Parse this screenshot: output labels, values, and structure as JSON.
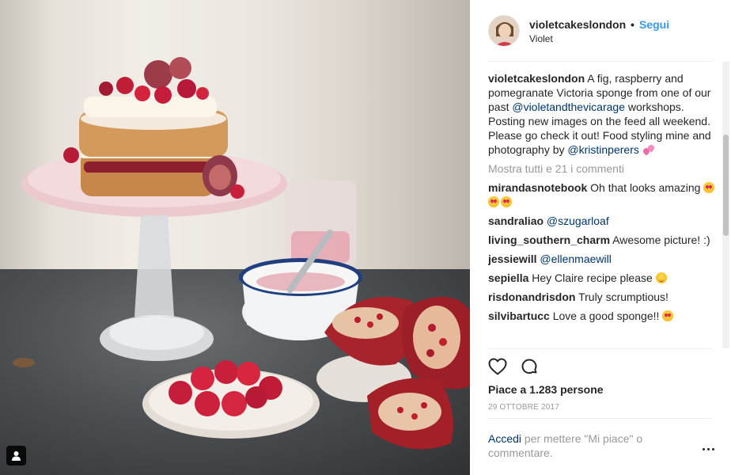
{
  "post": {
    "username": "violetcakeslondon",
    "separator": "•",
    "follow_label": "Segui",
    "full_name": "Violet",
    "caption": {
      "username": "violetcakeslondon",
      "text_1": " A fig, raspberry and pomegranate Victoria sponge from one of our past ",
      "mention_1": "@violetandthevicarage",
      "text_2": " workshops. Posting new images on the feed all weekend. Please go check it out! Food styling mine and photography by ",
      "mention_2": "@kristinperers",
      "emoji": "two-hearts"
    },
    "view_all_comments": "Mostra tutti e 21 i commenti",
    "comments": [
      {
        "username": "mirandasnotebook",
        "text": " Oh that looks amazing ",
        "emoji": "heart-eyes x3"
      },
      {
        "username": "sandraliao",
        "mention": "@szugarloaf"
      },
      {
        "username": "living_southern_charm",
        "text": " Awesome picture! :)"
      },
      {
        "username": "jessiewill",
        "mention": "@ellenmaewill"
      },
      {
        "username": "sepiella",
        "text": " Hey Claire recipe please ",
        "emoji": "blush"
      },
      {
        "username": "risdonandrisdon",
        "text": " Truly scrumptious!"
      },
      {
        "username": "silvibartucc",
        "text": " Love a good sponge!! ",
        "emoji": "heart-eyes"
      }
    ],
    "likes": "Piace a 1.283 persone",
    "date": "29 OTTOBRE 2017",
    "login_link": "Accedi",
    "login_text": " per mettere \"Mi piace\" o commentare."
  },
  "icons": {
    "like": "heart-outline-icon",
    "comment": "comment-bubble-icon",
    "more": "more-options-icon",
    "user_tag": "user-tag-icon"
  },
  "colors": {
    "link_blue": "#3897f0",
    "mention_navy": "#003569",
    "muted": "#999999",
    "text": "#262626"
  }
}
